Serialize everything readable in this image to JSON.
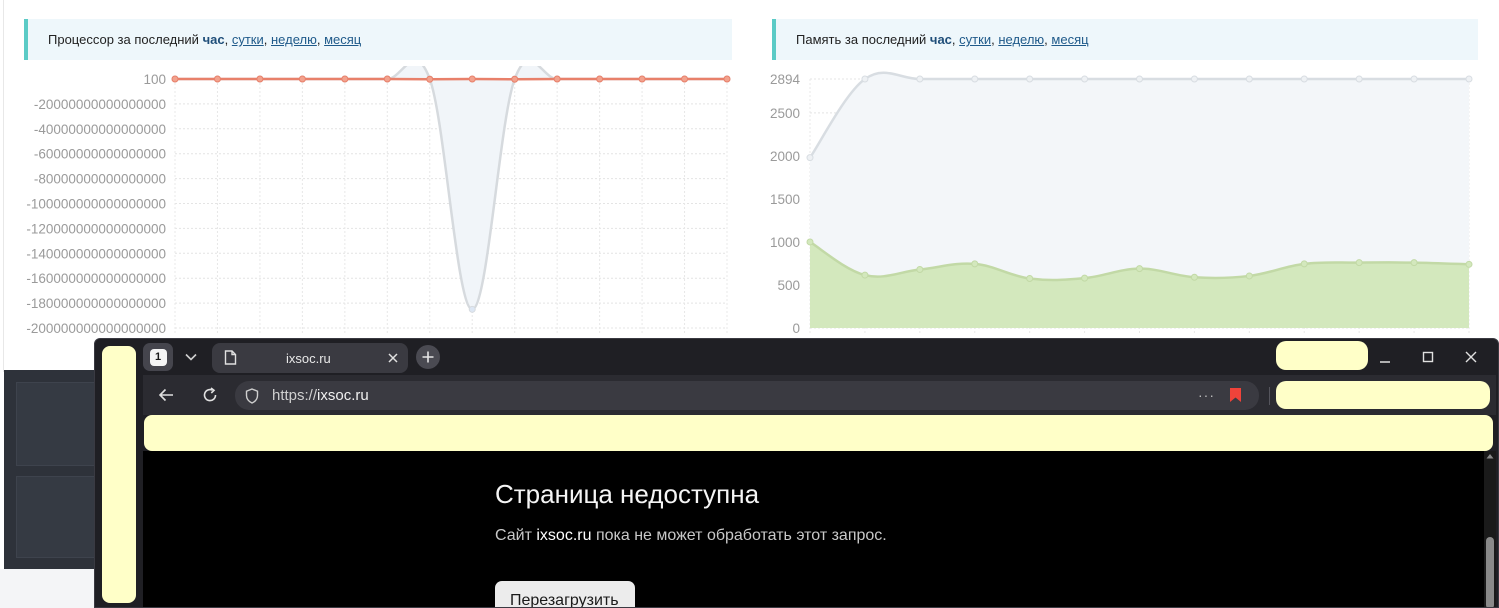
{
  "cpu_panel": {
    "prefix": "Процессор за последний",
    "current": "час",
    "sep": ",",
    "links": [
      "сутки",
      "неделю",
      "месяц"
    ]
  },
  "memory_panel": {
    "prefix": "Память за последний",
    "current": "час",
    "sep": ",",
    "links": [
      "сутки",
      "неделю",
      "месяц"
    ]
  },
  "chart_data": [
    {
      "type": "line",
      "title": "",
      "y_ticks": [
        "100",
        "-20000000000000000",
        "-40000000000000000",
        "-60000000000000000",
        "-80000000000000000",
        "-100000000000000000",
        "-120000000000000000",
        "-140000000000000000",
        "-160000000000000000",
        "-180000000000000000",
        "-200000000000000000"
      ],
      "ylim": [
        -200000000000000000,
        100
      ],
      "grid": true,
      "series": [
        {
          "values": [
            100,
            100,
            100,
            100,
            100,
            100,
            100,
            -185000000000000000,
            100,
            100,
            100,
            100,
            100,
            100
          ],
          "color": "#d6dade",
          "fill": "#f1f5f9"
        },
        {
          "values": [
            100,
            100,
            100,
            100,
            100,
            100,
            -200000000000000,
            100,
            -200000000000000,
            100,
            100,
            100,
            100,
            100
          ],
          "color": "#e8806a",
          "fill": "#f2a28e"
        }
      ]
    },
    {
      "type": "area",
      "title": "",
      "y_ticks": [
        "2894",
        "2500",
        "2000",
        "1500",
        "1000",
        "500",
        "0"
      ],
      "ylim": [
        0,
        2894
      ],
      "grid": true,
      "series": [
        {
          "values": [
            1980,
            2894,
            2894,
            2894,
            2894,
            2894,
            2894,
            2894,
            2894,
            2894,
            2894,
            2894,
            2894
          ],
          "color": "#d8dde2",
          "fill": "#f3f6f9"
        },
        {
          "values": [
            1000,
            615,
            680,
            745,
            575,
            580,
            690,
            590,
            605,
            745,
            760,
            760,
            740
          ],
          "color": "#c2d9a6",
          "fill": "#d3e8bd"
        }
      ]
    }
  ],
  "browser": {
    "tab_count": "1",
    "tab_title": "ixsoc.ru",
    "url_scheme": "https://",
    "url_host": "ixsoc.ru",
    "more_label": "···",
    "error_title": "Страница недоступна",
    "error_before": "Сайт",
    "error_host": "ixsoc.ru",
    "error_after": "пока не может обработать этот запрос.",
    "reload_label": "Перезагрузить",
    "colors": {
      "frame": "#1f1f24",
      "highlight": "#ffffc8",
      "bookmark": "#f0433a"
    }
  }
}
